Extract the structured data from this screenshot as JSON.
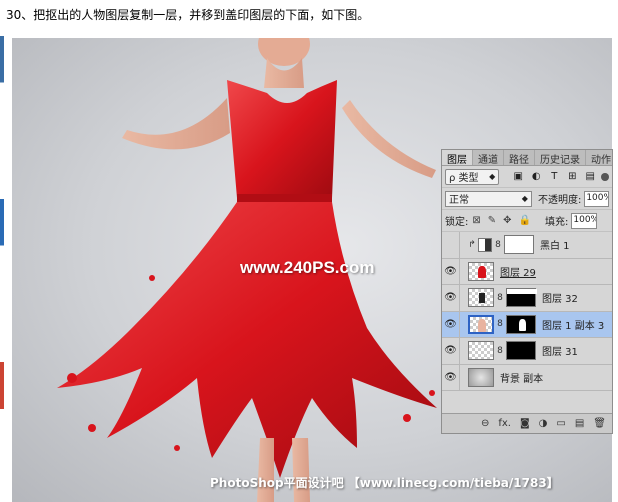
{
  "instruction": "30、把抠出的人物图层复制一层，并移到盖印图层的下面，如下图。",
  "watermark": "www.240PS.com",
  "footer_credit": "PhotoShop平面设计吧 【www.linecg.com/tieba/1783】",
  "panel": {
    "tabs": [
      "图层",
      "通道",
      "路径",
      "历史记录",
      "动作"
    ],
    "filter_label": "ρ 类型",
    "filter_icons": [
      "image-filter-icon",
      "adjustment-filter-icon",
      "text-filter-icon",
      "shape-filter-icon",
      "smart-filter-icon"
    ],
    "filter_icon_glyphs": [
      "▣",
      "◐",
      "T",
      "⊞",
      "▤"
    ],
    "blend_mode": "正常",
    "opacity_label": "不透明度:",
    "opacity_value": "100%",
    "lock_label": "锁定:",
    "lock_icons": [
      "⊠",
      "✎",
      "✥",
      "🔒"
    ],
    "fill_label": "填充:",
    "fill_value": "100%",
    "layers": [
      {
        "name": "黑白 1",
        "kind": "adjustment",
        "visible": false,
        "selected": false
      },
      {
        "name": "图层 29",
        "kind": "pixel-red",
        "visible": true,
        "selected": false,
        "underlined": true
      },
      {
        "name": "图层 32",
        "kind": "pixel-mask",
        "visible": true,
        "selected": false
      },
      {
        "name": "图层 1 副本 3",
        "kind": "pixel-mask-person",
        "visible": true,
        "selected": true
      },
      {
        "name": "图层 31",
        "kind": "pixel-mask-black",
        "visible": true,
        "selected": false
      },
      {
        "name": "背景 副本",
        "kind": "pixel-gray",
        "visible": true,
        "selected": false
      }
    ],
    "bottom_icons": [
      "⊖",
      "fx.",
      "◙",
      "◑",
      "▭",
      "▤",
      "🗑"
    ]
  },
  "colors": {
    "dress": "#d8141c",
    "dress_highlight": "#f0484b",
    "selection": "#a9c6ef",
    "panel_bg": "#d6d6d6"
  }
}
